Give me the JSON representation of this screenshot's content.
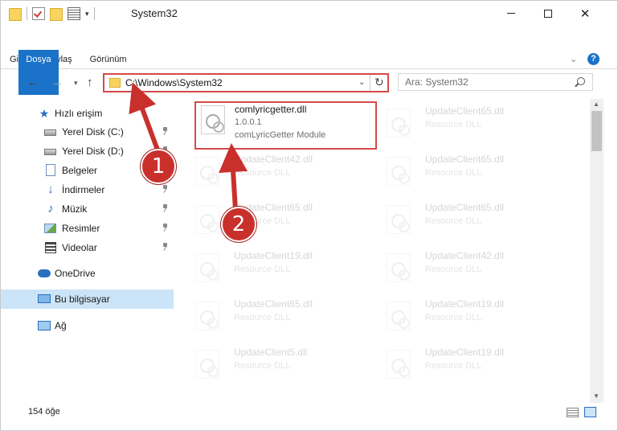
{
  "window": {
    "title": "System32"
  },
  "ribbon": {
    "tabs": [
      "Dosya",
      "Giriş",
      "Paylaş",
      "Görünüm"
    ],
    "help": "?"
  },
  "address": {
    "path": "C:\\Windows\\System32"
  },
  "search": {
    "placeholder": "Ara: System32"
  },
  "sidebar": {
    "items": [
      {
        "label": "Hızlı erişim",
        "icon": "star-icon"
      },
      {
        "label": "Yerel Disk (C:)",
        "icon": "disk-icon",
        "pinned": true
      },
      {
        "label": "Yerel Disk (D:)",
        "icon": "disk-icon",
        "pinned": true
      },
      {
        "label": "Belgeler",
        "icon": "documents-icon"
      },
      {
        "label": "İndirmeler",
        "icon": "downloads-icon",
        "pinned": true
      },
      {
        "label": "Müzik",
        "icon": "music-icon",
        "pinned": true
      },
      {
        "label": "Resimler",
        "icon": "pictures-icon",
        "pinned": true
      },
      {
        "label": "Videolar",
        "icon": "videos-icon",
        "pinned": true
      },
      {
        "label": "OneDrive",
        "icon": "onedrive-icon"
      },
      {
        "label": "Bu bilgisayar",
        "icon": "this-pc-icon",
        "selected": true
      },
      {
        "label": "Ağ",
        "icon": "network-icon"
      }
    ]
  },
  "files": {
    "highlight": {
      "name": "comlyricgetter.dll",
      "version": "1.0.0.1",
      "description": "comLyricGetter Module"
    },
    "left": [
      {
        "name": "UpdateClient42.dll",
        "type": "Resource DLL"
      },
      {
        "name": "UpdateClient65.dll",
        "type": "Resource DLL"
      },
      {
        "name": "UpdateClient19.dll",
        "type": "Resource DLL"
      },
      {
        "name": "UpdateClient65.dll",
        "type": "Resource DLL"
      },
      {
        "name": "UpdateClient5.dll",
        "type": "Resource DLL"
      }
    ],
    "right": [
      {
        "name": "UpdateClient65.dll",
        "type": "Resource DLL"
      },
      {
        "name": "UpdateClient65.dll",
        "type": "Resource DLL"
      },
      {
        "name": "UpdateClient65.dll",
        "type": "Resource DLL"
      },
      {
        "name": "UpdateClient42.dll",
        "type": "Resource DLL"
      },
      {
        "name": "UpdateClient19.dll",
        "type": "Resource DLL"
      },
      {
        "name": "UpdateClient19.dll",
        "type": "Resource DLL"
      }
    ]
  },
  "status": {
    "count": "154 öğe"
  },
  "annotations": {
    "step1": "1",
    "step2": "2",
    "color": "#c9302c"
  }
}
